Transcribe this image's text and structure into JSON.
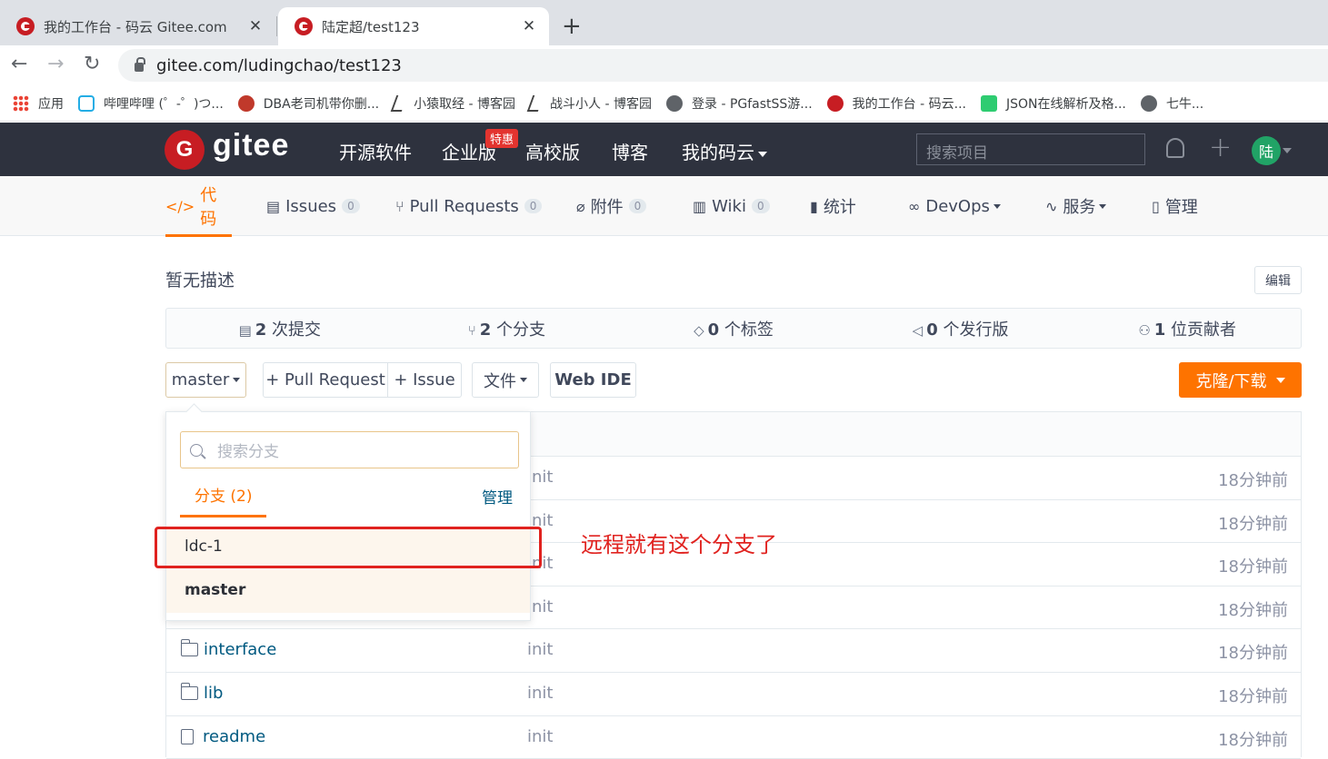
{
  "browser": {
    "tabs": [
      {
        "title": "我的工作台 - 码云 Gitee.com",
        "active": false
      },
      {
        "title": "陆定超/test123",
        "active": true
      }
    ],
    "url": "gitee.com/ludingchao/test123",
    "bookmarks": [
      {
        "label": "应用",
        "icon": "apps-icon"
      },
      {
        "label": "哔哩哔哩 (゜-゜)つ...",
        "icon": "bilibili-icon"
      },
      {
        "label": "DBA老司机带你删...",
        "icon": "dba-icon"
      },
      {
        "label": "小猿取经 - 博客园",
        "icon": "cnblogs-icon"
      },
      {
        "label": "战斗小人 - 博客园",
        "icon": "cnblogs-icon"
      },
      {
        "label": "登录 - PGfastSS游...",
        "icon": "globe-icon"
      },
      {
        "label": "我的工作台 - 码云...",
        "icon": "gitee-icon"
      },
      {
        "label": "JSON在线解析及格...",
        "icon": "json-icon"
      },
      {
        "label": "七牛...",
        "icon": "globe-icon"
      }
    ]
  },
  "header": {
    "logo_text": "gitee",
    "nav": [
      "开源软件",
      "企业版",
      "高校版",
      "博客",
      "我的码云"
    ],
    "special_badge": "特惠",
    "search_placeholder": "搜索项目",
    "avatar_text": "陆"
  },
  "repo_tabs": [
    {
      "label": "代码",
      "icon": "code-icon",
      "active": true
    },
    {
      "label": "Issues",
      "count": "0",
      "icon": "issue-icon"
    },
    {
      "label": "Pull Requests",
      "count": "0",
      "icon": "pull-request-icon"
    },
    {
      "label": "附件",
      "count": "0",
      "icon": "attachment-icon"
    },
    {
      "label": "Wiki",
      "count": "0",
      "icon": "wiki-icon"
    },
    {
      "label": "统计",
      "icon": "stats-icon"
    },
    {
      "label": "DevOps",
      "icon": "devops-icon"
    },
    {
      "label": "服务",
      "icon": "service-icon"
    },
    {
      "label": "管理",
      "icon": "manage-icon"
    }
  ],
  "description": "暂无描述",
  "edit_label": "编辑",
  "stats": [
    {
      "num": "2",
      "label": "次提交",
      "icon": "commit-icon"
    },
    {
      "num": "2",
      "label": "个分支",
      "icon": "branch-icon"
    },
    {
      "num": "0",
      "label": "个标签",
      "icon": "tag-icon"
    },
    {
      "num": "0",
      "label": "个发行版",
      "icon": "release-icon"
    },
    {
      "num": "1",
      "label": "位贡献者",
      "icon": "contributor-icon"
    }
  ],
  "controls": {
    "branch": "master",
    "pull_request": "+ Pull Request",
    "issue": "+ Issue",
    "file": "文件",
    "web_ide": "Web IDE",
    "clone": "克隆/下载"
  },
  "branch_dropdown": {
    "search_placeholder": "搜索分支",
    "tab_label": "分支 (2)",
    "manage_label": "管理",
    "branches": [
      "ldc-1",
      "master"
    ]
  },
  "files": [
    {
      "name": "",
      "msg": "init",
      "time": "18分钟前",
      "type": "hidden"
    },
    {
      "name": "",
      "msg": "init",
      "time": "18分钟前",
      "type": "hidden"
    },
    {
      "name": "",
      "msg": "init",
      "time": "18分钟前",
      "type": "hidden"
    },
    {
      "name": "",
      "msg": "init",
      "time": "18分钟前",
      "type": "hidden"
    },
    {
      "name": "interface",
      "msg": "init",
      "time": "18分钟前",
      "type": "folder"
    },
    {
      "name": "lib",
      "msg": "init",
      "time": "18分钟前",
      "type": "folder"
    },
    {
      "name": "readme",
      "msg": "init",
      "time": "18分钟前",
      "type": "file"
    }
  ],
  "annotation": "远程就有这个分支了",
  "colors": {
    "accent": "#fe7300",
    "header_bg": "#2e323e",
    "annotation": "#e0221f"
  }
}
